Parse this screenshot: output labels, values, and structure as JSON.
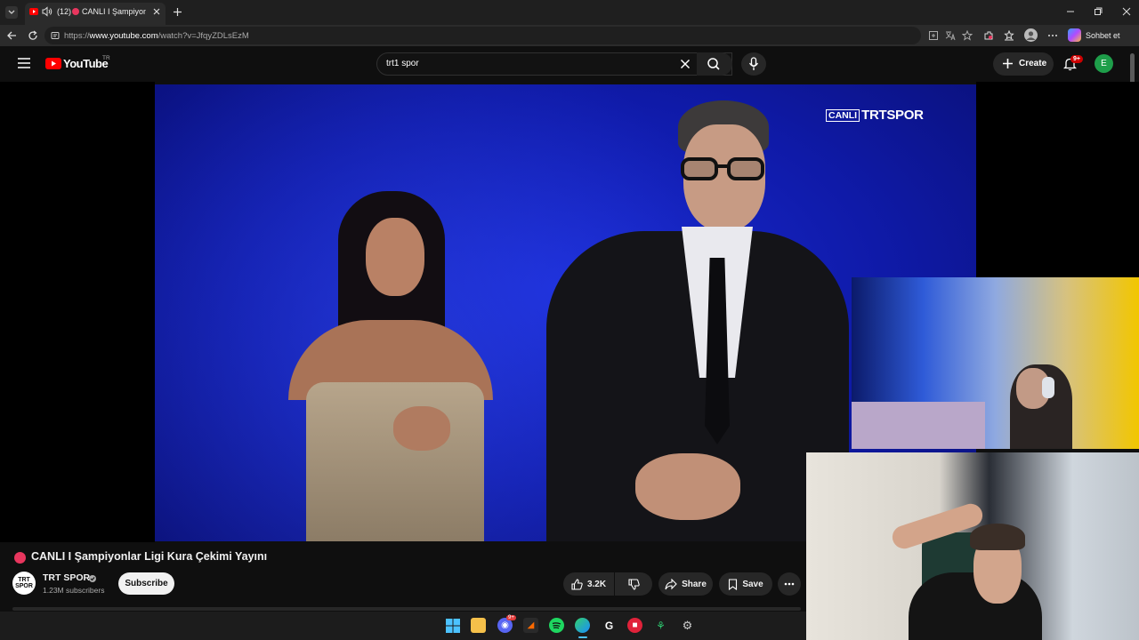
{
  "browser": {
    "tab": {
      "count_label": "(12)",
      "title": "CANLI I Şampiyonlar"
    },
    "url": {
      "prefix": "https://",
      "host": "www.youtube.com",
      "path": "/watch?v=JfqyZDLsEzM"
    },
    "copilot_label": "Sohbet et"
  },
  "youtube": {
    "logo_text": "YouTube",
    "region": "TR",
    "search_value": "trt1 spor",
    "create_label": "Create",
    "notification_badge": "9+",
    "account_initial": "E"
  },
  "video": {
    "overlay_live": "CANLI",
    "overlay_brand": "TRTSPOR",
    "title": "CANLI I Şampiyonlar Ligi Kura Çekimi Yayını",
    "channel": "TRT SPOR",
    "channel_avatar": "TRT SPOR",
    "subscribers": "1.23M subscribers",
    "subscribe_label": "Subscribe",
    "likes": "3.2K",
    "share_label": "Share",
    "save_label": "Save"
  },
  "taskbar": {
    "discord_badge": "9+"
  },
  "colors": {
    "accent_red": "#ff0000",
    "account_green": "#1e9e4a",
    "live_dot": "#e8365e",
    "video_blue": "#1a2bd6"
  }
}
